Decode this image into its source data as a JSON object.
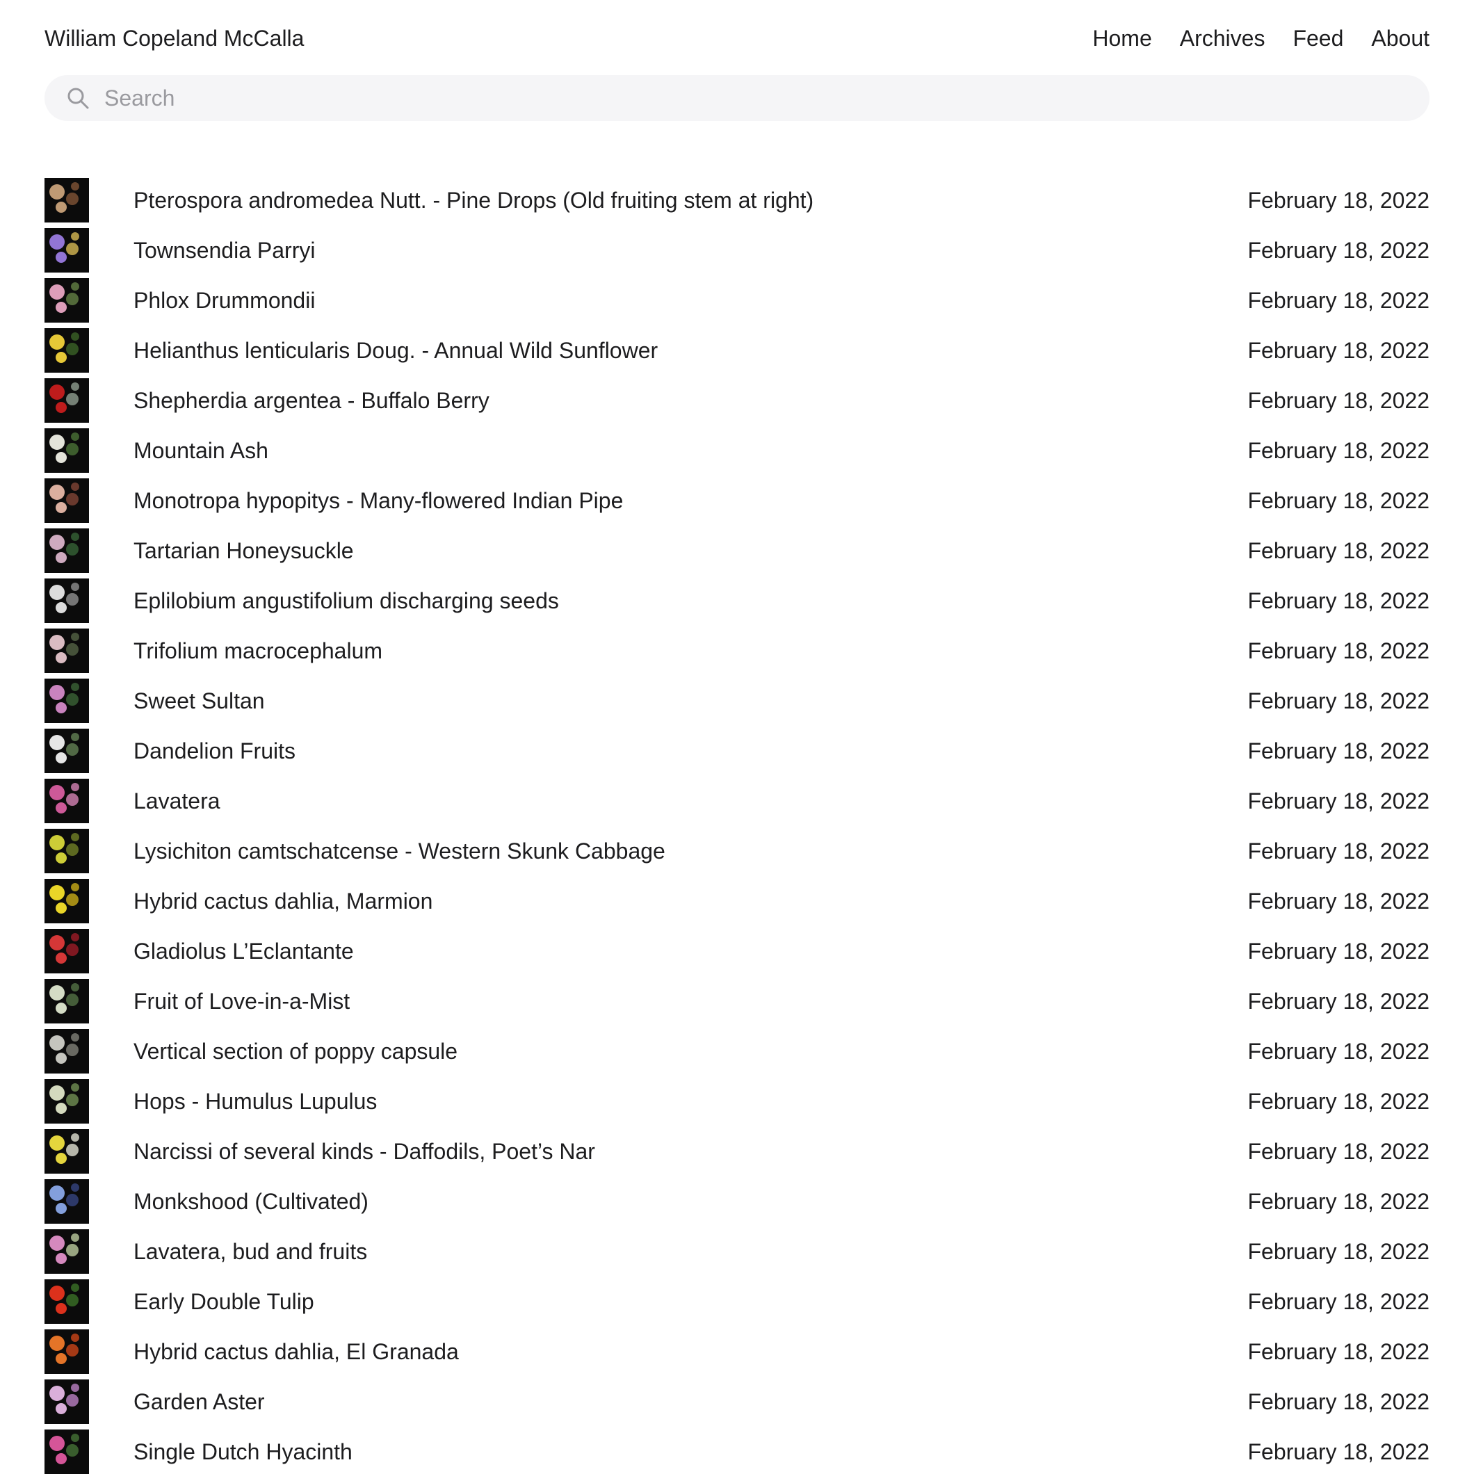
{
  "site": {
    "title": "William Copeland McCalla",
    "nav": [
      "Home",
      "Archives",
      "Feed",
      "About"
    ]
  },
  "search": {
    "placeholder": "Search",
    "icon": "search-icon"
  },
  "colors": {
    "search_bg": "#f5f5f7",
    "text": "#1d1d1f",
    "placeholder": "#9a9a9f",
    "thumb_bg": "#0b0b0b"
  },
  "posts": [
    {
      "title": "Pterospora andromedea Nutt. - Pine Drops (Old fruiting stem at right)",
      "date": "February 18, 2022",
      "thumb": [
        "#c9a27a",
        "#8a5a3a"
      ]
    },
    {
      "title": "Townsendia Parryi",
      "date": "February 18, 2022",
      "thumb": [
        "#9a7be0",
        "#e6c65a"
      ]
    },
    {
      "title": "Phlox Drummondii",
      "date": "February 18, 2022",
      "thumb": [
        "#e9a6c3",
        "#6b8a4a"
      ]
    },
    {
      "title": "Helianthus lenticularis Doug. - Annual Wild Sunflower",
      "date": "February 18, 2022",
      "thumb": [
        "#f2d33a",
        "#3f6a2a"
      ]
    },
    {
      "title": "Shepherdia argentea - Buffalo Berry",
      "date": "February 18, 2022",
      "thumb": [
        "#c81e1e",
        "#9aa89a"
      ]
    },
    {
      "title": "Mountain Ash",
      "date": "February 18, 2022",
      "thumb": [
        "#f0f0e6",
        "#4f7a3a"
      ]
    },
    {
      "title": "Monotropa hypopitys - Many-flowered Indian Pipe",
      "date": "February 18, 2022",
      "thumb": [
        "#e7b8a8",
        "#8a4a3a"
      ]
    },
    {
      "title": "Tartarian Honeysuckle",
      "date": "February 18, 2022",
      "thumb": [
        "#d9b3c9",
        "#3a6a3a"
      ]
    },
    {
      "title": "Eplilobium angustifolium discharging seeds",
      "date": "February 18, 2022",
      "thumb": [
        "#e8e8e8",
        "#9a9a9a"
      ]
    },
    {
      "title": "Trifolium macrocephalum",
      "date": "February 18, 2022",
      "thumb": [
        "#e6c6cc",
        "#5a6a4a"
      ]
    },
    {
      "title": "Sweet Sultan",
      "date": "February 18, 2022",
      "thumb": [
        "#d48ac8",
        "#3f6a3a"
      ]
    },
    {
      "title": "Dandelion Fruits",
      "date": "February 18, 2022",
      "thumb": [
        "#f2f2f2",
        "#6a8a5a"
      ]
    },
    {
      "title": "Lavatera",
      "date": "February 18, 2022",
      "thumb": [
        "#d85ea0",
        "#e48cc0"
      ]
    },
    {
      "title": "Lysichiton camtschatcense - Western Skunk Cabbage",
      "date": "February 18, 2022",
      "thumb": [
        "#d8d83a",
        "#7a8a2a"
      ]
    },
    {
      "title": "Hybrid cactus dahlia, Marmion",
      "date": "February 18, 2022",
      "thumb": [
        "#f5e02a",
        "#d8b81a"
      ]
    },
    {
      "title": "Gladiolus L’Eclantante",
      "date": "February 18, 2022",
      "thumb": [
        "#e03a3a",
        "#a81e2a"
      ]
    },
    {
      "title": "Fruit of Love-in-a-Mist",
      "date": "February 18, 2022",
      "thumb": [
        "#dfe8d0",
        "#5a7a4a"
      ]
    },
    {
      "title": "Vertical section of poppy capsule",
      "date": "February 18, 2022",
      "thumb": [
        "#d0d0c8",
        "#8a8a80"
      ]
    },
    {
      "title": "Hops - Humulus Lupulus",
      "date": "February 18, 2022",
      "thumb": [
        "#dfe6c8",
        "#7a9a5a"
      ]
    },
    {
      "title": "Narcissi of several kinds - Daffodils, Poet’s Nar",
      "date": "February 18, 2022",
      "thumb": [
        "#f0e040",
        "#f0f0e0"
      ]
    },
    {
      "title": "Monkshood (Cultivated)",
      "date": "February 18, 2022",
      "thumb": [
        "#8aa8e8",
        "#3a4a8a"
      ]
    },
    {
      "title": "Lavatera, bud and fruits",
      "date": "February 18, 2022",
      "thumb": [
        "#e090c8",
        "#c8d8a8"
      ]
    },
    {
      "title": "Early Double Tulip",
      "date": "February 18, 2022",
      "thumb": [
        "#e8341e",
        "#3f7a2a"
      ]
    },
    {
      "title": "Hybrid cactus dahlia, El Granada",
      "date": "February 18, 2022",
      "thumb": [
        "#f07a2a",
        "#d84a1a"
      ]
    },
    {
      "title": "Garden Aster",
      "date": "February 18, 2022",
      "thumb": [
        "#e6b8e6",
        "#c88ad0"
      ]
    },
    {
      "title": "Single Dutch Hyacinth",
      "date": "February 18, 2022",
      "thumb": [
        "#e05aa0",
        "#4a7a3a"
      ]
    }
  ]
}
